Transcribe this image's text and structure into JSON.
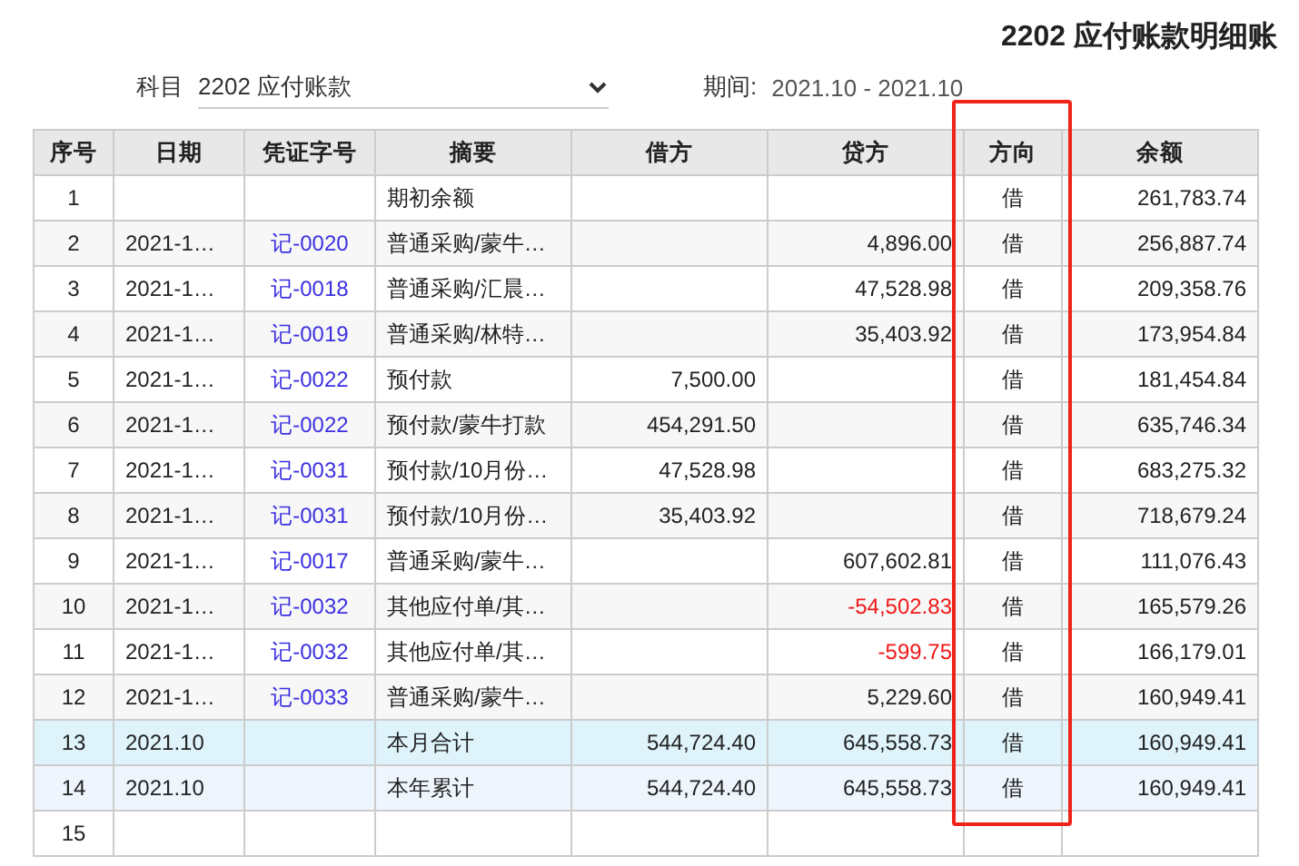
{
  "title": "2202 应付账款明细账",
  "filter": {
    "subject_label": "科目",
    "subject_value": "2202 应付账款",
    "period_label": "期间:",
    "period_value": "2021.10 - 2021.10"
  },
  "columns": [
    {
      "label": "序号",
      "highlighted": false
    },
    {
      "label": "日期",
      "highlighted": false
    },
    {
      "label": "凭证字号",
      "highlighted": false
    },
    {
      "label": "摘要",
      "highlighted": false
    },
    {
      "label": "借方",
      "highlighted": false
    },
    {
      "label": "贷方",
      "highlighted": false
    },
    {
      "label": "方向",
      "highlighted": true
    },
    {
      "label": "余额",
      "highlighted": false
    }
  ],
  "rows": [
    {
      "kind": "normal",
      "no": "1",
      "summary": "期初余额",
      "direction": "借",
      "balance": "261,783.74"
    },
    {
      "kind": "normal",
      "no": "2",
      "date": "2021-1…",
      "voucher": "记-0020",
      "summary": "普通采购/蒙牛…",
      "credit": {
        "text": "4,896.00",
        "negative": false
      },
      "direction": "借",
      "balance": "256,887.74"
    },
    {
      "kind": "normal",
      "no": "3",
      "date": "2021-1…",
      "voucher": "记-0018",
      "summary": "普通采购/汇晨…",
      "credit": {
        "text": "47,528.98",
        "negative": false
      },
      "direction": "借",
      "balance": "209,358.76"
    },
    {
      "kind": "normal",
      "no": "4",
      "date": "2021-1…",
      "voucher": "记-0019",
      "summary": "普通采购/林特…",
      "credit": {
        "text": "35,403.92",
        "negative": false
      },
      "direction": "借",
      "balance": "173,954.84"
    },
    {
      "kind": "normal",
      "no": "5",
      "date": "2021-1…",
      "voucher": "记-0022",
      "summary": "预付款",
      "debit": "7,500.00",
      "direction": "借",
      "balance": "181,454.84"
    },
    {
      "kind": "normal",
      "no": "6",
      "date": "2021-1…",
      "voucher": "记-0022",
      "summary": "预付款/蒙牛打款",
      "debit": "454,291.50",
      "direction": "借",
      "balance": "635,746.34"
    },
    {
      "kind": "normal",
      "no": "7",
      "date": "2021-1…",
      "voucher": "记-0031",
      "summary": "预付款/10月份…",
      "debit": "47,528.98",
      "direction": "借",
      "balance": "683,275.32"
    },
    {
      "kind": "normal",
      "no": "8",
      "date": "2021-1…",
      "voucher": "记-0031",
      "summary": "预付款/10月份…",
      "debit": "35,403.92",
      "direction": "借",
      "balance": "718,679.24"
    },
    {
      "kind": "normal",
      "no": "9",
      "date": "2021-1…",
      "voucher": "记-0017",
      "summary": "普通采购/蒙牛…",
      "credit": {
        "text": "607,602.81",
        "negative": false
      },
      "direction": "借",
      "balance": "111,076.43"
    },
    {
      "kind": "normal",
      "no": "10",
      "date": "2021-1…",
      "voucher": "记-0032",
      "summary": "其他应付单/其…",
      "credit": {
        "text": "-54,502.83",
        "negative": true
      },
      "direction": "借",
      "balance": "165,579.26"
    },
    {
      "kind": "normal",
      "no": "11",
      "date": "2021-1…",
      "voucher": "记-0032",
      "summary": "其他应付单/其…",
      "credit": {
        "text": "-599.75",
        "negative": true
      },
      "direction": "借",
      "balance": "166,179.01"
    },
    {
      "kind": "normal",
      "no": "12",
      "date": "2021-1…",
      "voucher": "记-0033",
      "summary": "普通采购/蒙牛…",
      "credit": {
        "text": "5,229.60",
        "negative": false
      },
      "direction": "借",
      "balance": "160,949.41"
    },
    {
      "kind": "month_total",
      "no": "13",
      "date": "2021.10",
      "summary": "本月合计",
      "debit": "544,724.40",
      "credit": {
        "text": "645,558.73",
        "negative": false
      },
      "direction": "借",
      "balance": "160,949.41"
    },
    {
      "kind": "year_total",
      "no": "14",
      "date": "2021.10",
      "summary": "本年累计",
      "debit": "544,724.40",
      "credit": {
        "text": "645,558.73",
        "negative": false
      },
      "direction": "借",
      "balance": "160,949.41"
    },
    {
      "kind": "normal",
      "no": "15"
    }
  ]
}
